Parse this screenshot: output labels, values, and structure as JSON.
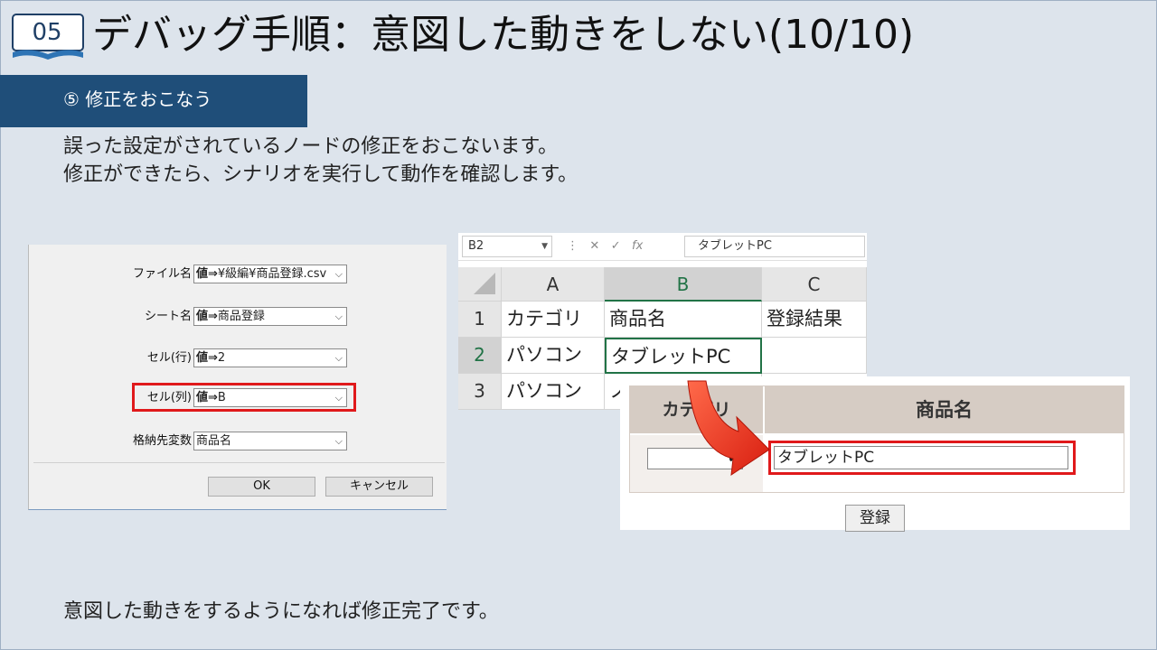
{
  "header": {
    "badge_number": "05",
    "title": "デバッグ手順：意図した動きをしない(10/10)"
  },
  "step": {
    "label": "⑤ 修正をおこなう"
  },
  "description": {
    "line1": "誤った設定がされているノードの修正をおこないます。",
    "line2": "修正ができたら、シナリオを実行して動作を確認します。"
  },
  "dialog": {
    "rows": [
      {
        "label": "ファイル名",
        "prefix": "値⇒",
        "value": "¥級編¥商品登録.csv"
      },
      {
        "label": "シート名",
        "prefix": "値⇒",
        "value": "商品登録"
      },
      {
        "label": "セル(行)",
        "prefix": "値⇒",
        "value": "2"
      },
      {
        "label": "セル(列)",
        "prefix": "値⇒",
        "value": "B"
      },
      {
        "label": "格納先変数",
        "prefix": "",
        "value": "商品名"
      }
    ],
    "ok_label": "OK",
    "cancel_label": "キャンセル"
  },
  "excel": {
    "name_box": "B2",
    "formula": "タブレットPC",
    "fx_label": "fx",
    "columns": [
      "A",
      "B",
      "C"
    ],
    "rows": [
      {
        "num": "1",
        "cells": [
          "カテゴリ",
          "商品名",
          "登録結果"
        ]
      },
      {
        "num": "2",
        "cells": [
          "パソコン",
          "タブレットPC",
          ""
        ]
      },
      {
        "num": "3",
        "cells": [
          "パソコン",
          "ノ",
          ""
        ]
      }
    ]
  },
  "webform": {
    "header_category": "カテゴリ",
    "header_product": "商品名",
    "product_value": "タブレットPC",
    "register_label": "登録"
  },
  "footer": {
    "text": "意図した動きをするようになれば修正完了です。"
  },
  "colors": {
    "step_bar": "#1f4e79",
    "highlight": "#e0191b",
    "arrow": "#e8301e",
    "excel_green": "#217346"
  }
}
